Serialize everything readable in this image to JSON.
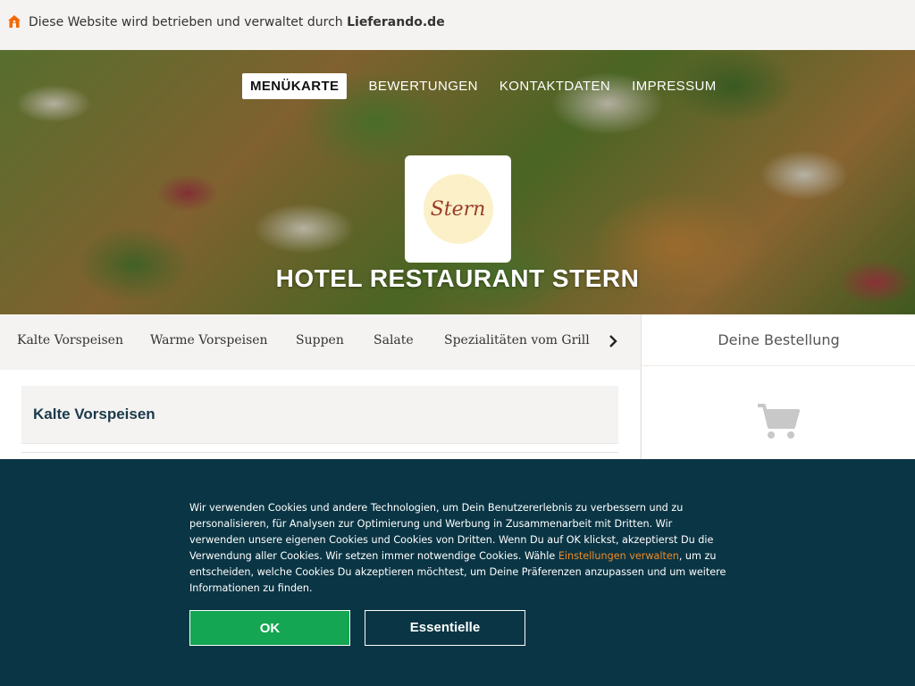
{
  "topbar": {
    "notice_prefix": "Diese Website wird betrieben und verwaltet durch ",
    "notice_brand": "Lieferando.de",
    "icon": "house-icon",
    "icon_color": "#f36805"
  },
  "nav": {
    "items": [
      {
        "label": "MENÜKARTE",
        "active": true
      },
      {
        "label": "BEWERTUNGEN",
        "active": false
      },
      {
        "label": "KONTAKTDATEN",
        "active": false
      },
      {
        "label": "IMPRESSUM",
        "active": false
      }
    ]
  },
  "hero": {
    "logo_text": "Stern",
    "restaurant_name": "HOTEL RESTAURANT STERN"
  },
  "categories": {
    "items": [
      "Kalte Vorspeisen",
      "Warme Vorspeisen",
      "Suppen",
      "Salate",
      "Spezialitäten vom Grill"
    ],
    "next_icon": "chevron-right-icon"
  },
  "order": {
    "title": "Deine Bestellung",
    "icon": "cart-icon"
  },
  "menu": {
    "section_title": "Kalte Vorspeisen"
  },
  "cookie": {
    "text_before_link": "Wir verwenden Cookies und andere Technologien, um Dein Benutzererlebnis zu verbessern und zu personalisieren, für Analysen zur Optimierung und Werbung in Zusammenarbeit mit Dritten. Wir verwenden unsere eigenen Cookies und Cookies von Dritten. Wenn Du auf OK klickst, akzeptierst Du die Verwendung aller Cookies. Wir setzen immer notwendige Cookies. Wähle ",
    "link_text": "Einstellungen verwalten",
    "text_after_link": ", um zu entscheiden, welche Cookies Du akzeptieren möchtest, um Deine Präferenzen anzupassen und um weitere Informationen zu finden.",
    "ok_label": "OK",
    "essential_label": "Essentielle",
    "background_color": "#0a3544",
    "ok_color": "#14a652",
    "link_color": "#f08a24"
  }
}
